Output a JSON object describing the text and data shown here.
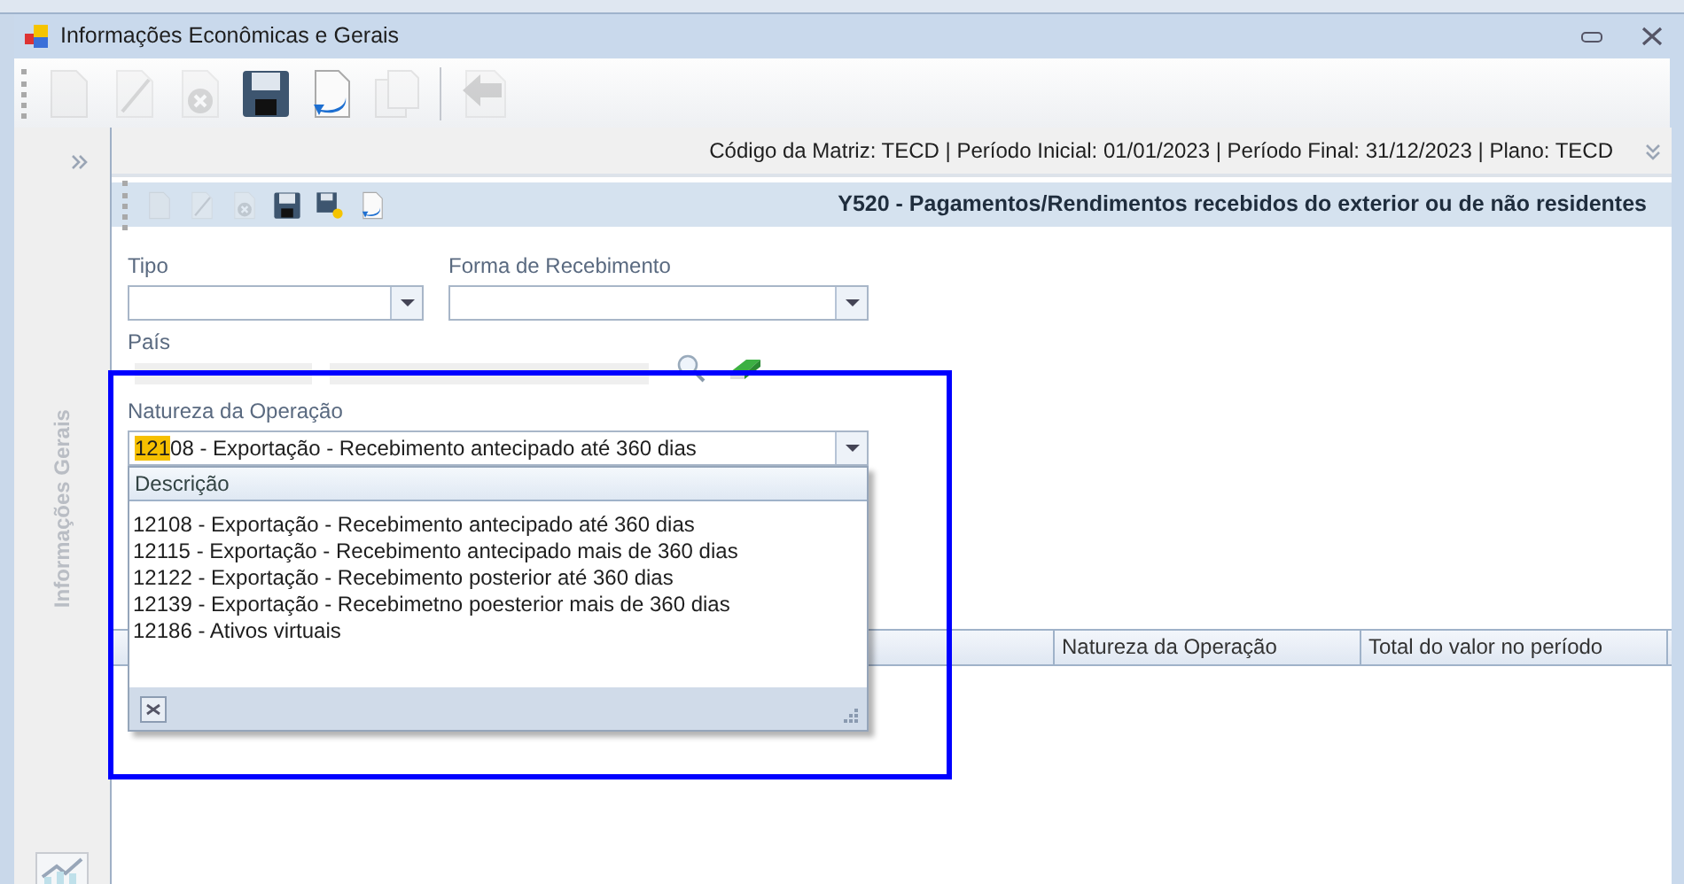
{
  "window": {
    "title": "Informações Econômicas e Gerais"
  },
  "toolbar": [
    {
      "kind": "new",
      "disabled": true
    },
    {
      "kind": "edit",
      "disabled": true
    },
    {
      "kind": "delete",
      "disabled": true
    },
    {
      "kind": "save",
      "disabled": false
    },
    {
      "kind": "undo",
      "disabled": false
    },
    {
      "kind": "copy",
      "disabled": true
    },
    {
      "kind": "back",
      "disabled": true
    }
  ],
  "sidebar": {
    "label": "Informações Gerais"
  },
  "info_bar": "Código da Matriz: TECD | Período Inicial: 01/01/2023 | Período Final: 31/12/2023 | Plano: TECD",
  "panel": {
    "title": "Y520 - Pagamentos/Rendimentos recebidos do exterior ou de não residentes",
    "toolbar": [
      {
        "kind": "new",
        "disabled": true
      },
      {
        "kind": "edit",
        "disabled": true
      },
      {
        "kind": "delete",
        "disabled": true
      },
      {
        "kind": "save",
        "disabled": false
      },
      {
        "kind": "savenew",
        "disabled": false
      },
      {
        "kind": "undo",
        "disabled": false
      }
    ]
  },
  "form": {
    "tipo": {
      "label": "Tipo"
    },
    "forma": {
      "label": "Forma de Recebimento"
    },
    "pais": {
      "label": "País"
    },
    "natureza": {
      "label": "Natureza da Operação",
      "match": "121",
      "value_rest": "08 - Exportação - Recebimento antecipado até 360 dias"
    }
  },
  "dropdown": {
    "header": "Descrição",
    "items": [
      "12108 - Exportação - Recebimento antecipado até 360 dias",
      "12115 - Exportação - Recebimento antecipado mais de 360 dias",
      "12122 - Exportação - Recebimento posterior até 360 dias",
      "12139 - Exportação - Recebimetno poesterior mais de 360 dias",
      "12186 - Ativos virtuais"
    ]
  },
  "table": {
    "columns": [
      "Natureza da Operação",
      "Total do valor no período"
    ]
  }
}
